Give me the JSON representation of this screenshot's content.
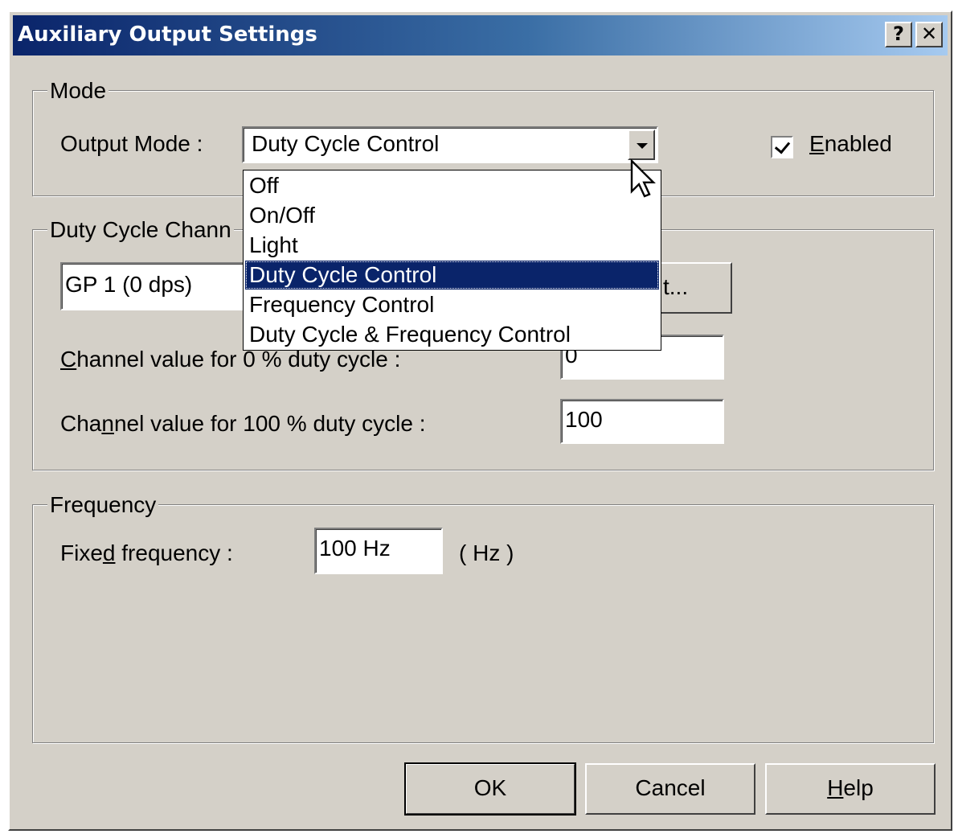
{
  "window": {
    "title": "Auxiliary Output Settings",
    "help_btn": "?",
    "close_btn": "✕"
  },
  "mode": {
    "legend": "Mode",
    "output_mode_label": "Output Mode :",
    "output_mode_value": "Duty Cycle Control",
    "enabled_label": "Enabled",
    "enabled_checked": true,
    "options": [
      "Off",
      "On/Off",
      "Light",
      "Duty Cycle Control",
      "Frequency Control",
      "Duty Cycle & Frequency Control"
    ],
    "selected_option": "Duty Cycle Control"
  },
  "duty": {
    "legend": "Duty Cycle Chann",
    "channel_value": "GP  1 (0 dps)",
    "select_btn_visible": "t...",
    "zero_label": "Channel value for 0 % duty cycle :",
    "zero_value": "0",
    "hundred_label": "Channel value for 100 % duty cycle :",
    "hundred_value": "100"
  },
  "frequency": {
    "legend": "Frequency",
    "fixed_label": "Fixed frequency :",
    "fixed_value": "100 Hz",
    "unit": "( Hz )"
  },
  "buttons": {
    "ok": "OK",
    "cancel": "Cancel",
    "help": "Help"
  }
}
